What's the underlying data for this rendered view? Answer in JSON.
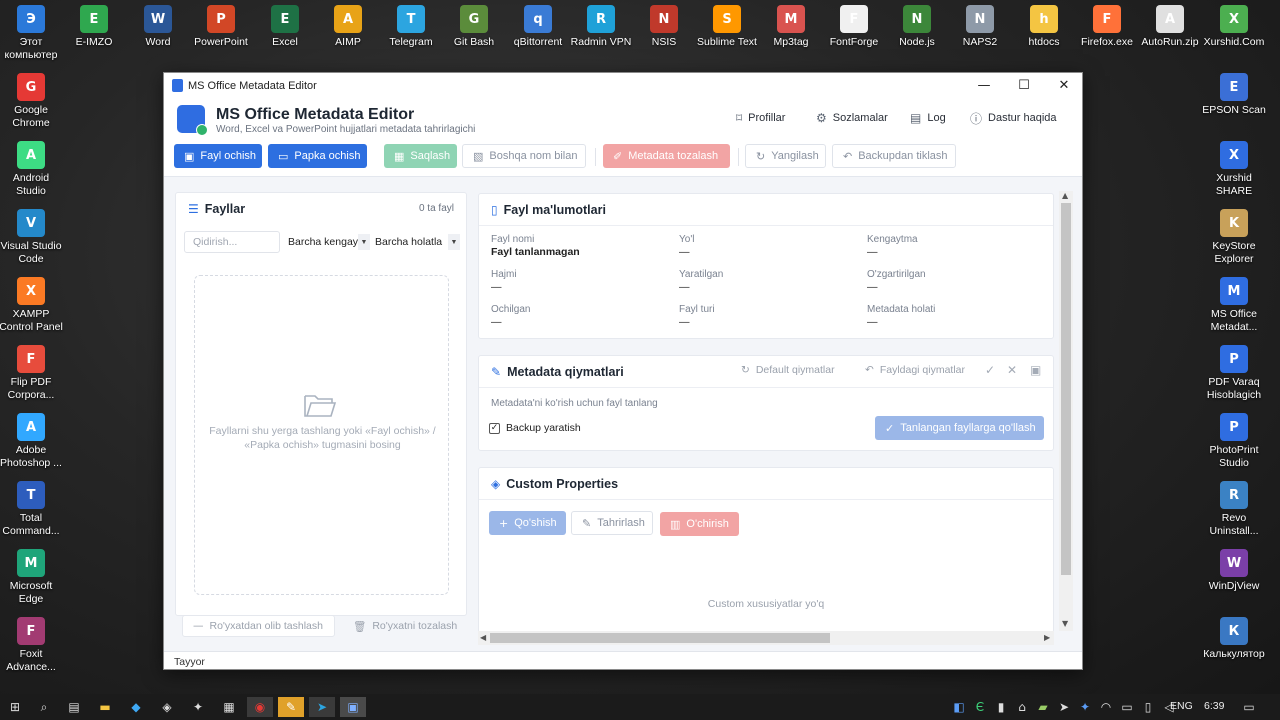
{
  "desktop": {
    "top_icons": [
      {
        "label": "Этот компьютер",
        "name": "this-pc-icon",
        "color": "#2b79d9"
      },
      {
        "label": "E-IMZO",
        "name": "e-imzo-icon",
        "color": "#2fa84f"
      },
      {
        "label": "Word",
        "name": "word-icon",
        "color": "#2b5797"
      },
      {
        "label": "PowerPoint",
        "name": "powerpoint-icon",
        "color": "#d24726"
      },
      {
        "label": "Excel",
        "name": "excel-icon",
        "color": "#1e7145"
      },
      {
        "label": "AIMP",
        "name": "aimp-icon",
        "color": "#e8a317"
      },
      {
        "label": "Telegram",
        "name": "telegram-icon",
        "color": "#2ca5e0"
      },
      {
        "label": "Git Bash",
        "name": "git-bash-icon",
        "color": "#5b8c3b"
      },
      {
        "label": "qBittorrent",
        "name": "qbittorrent-icon",
        "color": "#3a7bd5"
      },
      {
        "label": "Radmin VPN",
        "name": "radmin-vpn-icon",
        "color": "#1fa1d8"
      },
      {
        "label": "NSIS",
        "name": "nsis-icon",
        "color": "#c0392b"
      },
      {
        "label": "Sublime Text",
        "name": "sublime-text-icon",
        "color": "#ff9800"
      },
      {
        "label": "Mp3tag",
        "name": "mp3tag-icon",
        "color": "#d9534f"
      },
      {
        "label": "FontForge",
        "name": "fontforge-icon",
        "color": "#f0f0f0"
      },
      {
        "label": "Node.js",
        "name": "nodejs-icon",
        "color": "#3c873a"
      },
      {
        "label": "NAPS2",
        "name": "naps2-icon",
        "color": "#8e9aa8"
      },
      {
        "label": "htdocs",
        "name": "htdocs-folder-icon",
        "color": "#f4c542"
      },
      {
        "label": "Firefox.exe",
        "name": "firefox-icon",
        "color": "#ff7139"
      },
      {
        "label": "AutoRun.zip",
        "name": "autorun-zip-icon",
        "color": "#e0e0e0"
      },
      {
        "label": "Xurshid.Com",
        "name": "xurshid-com-icon",
        "color": "#4caf50"
      }
    ],
    "left_icons": [
      {
        "label": "Google Chrome",
        "name": "google-chrome-icon",
        "color": "#e53935"
      },
      {
        "label": "Android Studio",
        "name": "android-studio-icon",
        "color": "#3ddc84"
      },
      {
        "label": "Visual Studio Code",
        "name": "vscode-icon",
        "color": "#2489ca"
      },
      {
        "label": "XAMPP Control Panel",
        "name": "xampp-icon",
        "color": "#fb7a24"
      },
      {
        "label": "Flip PDF Corpora...",
        "name": "flip-pdf-icon",
        "color": "#e74c3c"
      },
      {
        "label": "Adobe Photoshop ...",
        "name": "photoshop-icon",
        "color": "#31a8ff"
      },
      {
        "label": "Total Command...",
        "name": "total-commander-icon",
        "color": "#2d5dbd"
      },
      {
        "label": "Microsoft Edge",
        "name": "edge-icon",
        "color": "#1fa57a"
      },
      {
        "label": "Foxit Advance...",
        "name": "foxit-icon",
        "color": "#a23b72"
      }
    ],
    "right_icons": [
      {
        "label": "EPSON Scan",
        "name": "epson-scan-icon",
        "color": "#3b6fd6"
      },
      {
        "label": "Xurshid SHARE",
        "name": "xurshid-share-icon",
        "color": "#2f6de1"
      },
      {
        "label": "KeyStore Explorer",
        "name": "keystore-explorer-icon",
        "color": "#c8a15a"
      },
      {
        "label": "MS Office Metadat...",
        "name": "ms-office-metadata-icon",
        "color": "#2f6de1"
      },
      {
        "label": "PDF Varaq Hisoblagich",
        "name": "pdf-varaq-icon",
        "color": "#2f6de1"
      },
      {
        "label": "PhotoPrint Studio",
        "name": "photoprint-icon",
        "color": "#2f6de1"
      },
      {
        "label": "Revo Uninstall...",
        "name": "revo-uninstaller-icon",
        "color": "#3b82c4"
      },
      {
        "label": "WinDjView",
        "name": "windjview-icon",
        "color": "#7b3fa8"
      },
      {
        "label": "Калькулятор",
        "name": "calculator-icon",
        "color": "#3a78c3"
      }
    ]
  },
  "window": {
    "title": "MS Office Metadata Editor",
    "header_title": "MS Office Metadata Editor",
    "header_subtitle": "Word, Excel va PowerPoint hujjatlari metadata tahrirlagichi",
    "nav": {
      "profiles": "Profillar",
      "settings": "Sozlamalar",
      "log": "Log",
      "about": "Dastur haqida"
    },
    "toolbar": {
      "open_file": "Fayl ochish",
      "open_folder": "Papka ochish",
      "save": "Saqlash",
      "save_as": "Boshqa nom bilan",
      "clear_metadata": "Metadata tozalash",
      "refresh": "Yangilash",
      "restore_backup": "Backupdan tiklash"
    },
    "files_panel": {
      "title": "Fayllar",
      "count": "0 ta fayl",
      "search_placeholder": "Qidirish...",
      "filter_ext": "Barcha kengay",
      "filter_status": "Barcha holatla",
      "drop_text": "Fayllarni shu yerga tashlang yoki «Fayl ochish» / «Papka ochish» tugmasini bosing",
      "remove_button": "Ro'yxatdan olib tashlash",
      "clear_button": "Ro'yxatni tozalash"
    },
    "file_info": {
      "title": "Fayl ma'lumotlari",
      "fields": [
        {
          "label": "Fayl nomi",
          "value": "Fayl tanlanmagan"
        },
        {
          "label": "Yo'l",
          "value": "—"
        },
        {
          "label": "Kengaytma",
          "value": "—"
        },
        {
          "label": "Hajmi",
          "value": "—"
        },
        {
          "label": "Yaratilgan",
          "value": "—"
        },
        {
          "label": "O'zgartirilgan",
          "value": "—"
        },
        {
          "label": "Ochilgan",
          "value": "—"
        },
        {
          "label": "Fayl turi",
          "value": "—"
        },
        {
          "label": "Metadata holati",
          "value": "—"
        }
      ]
    },
    "metadata": {
      "title": "Metadata qiymatlari",
      "default_values": "Default qiymatlar",
      "file_values": "Fayldagi qiymatlar",
      "hint": "Metadata'ni ko'rish uchun fayl tanlang",
      "backup_label": "Backup yaratish",
      "apply_button": "Tanlangan fayllarga qo'llash"
    },
    "custom": {
      "title": "Custom Properties",
      "add": "Qo'shish",
      "edit": "Tahrirlash",
      "delete": "O'chirish",
      "empty": "Custom xususiyatlar yo'q"
    },
    "status": "Tayyor"
  },
  "taskbar": {
    "lang": "ENG",
    "time": "6:39"
  },
  "colors": {
    "primary": "#2d6fe0",
    "save_disabled": "#8fd4b4",
    "danger_disabled": "#f2a4a4"
  }
}
